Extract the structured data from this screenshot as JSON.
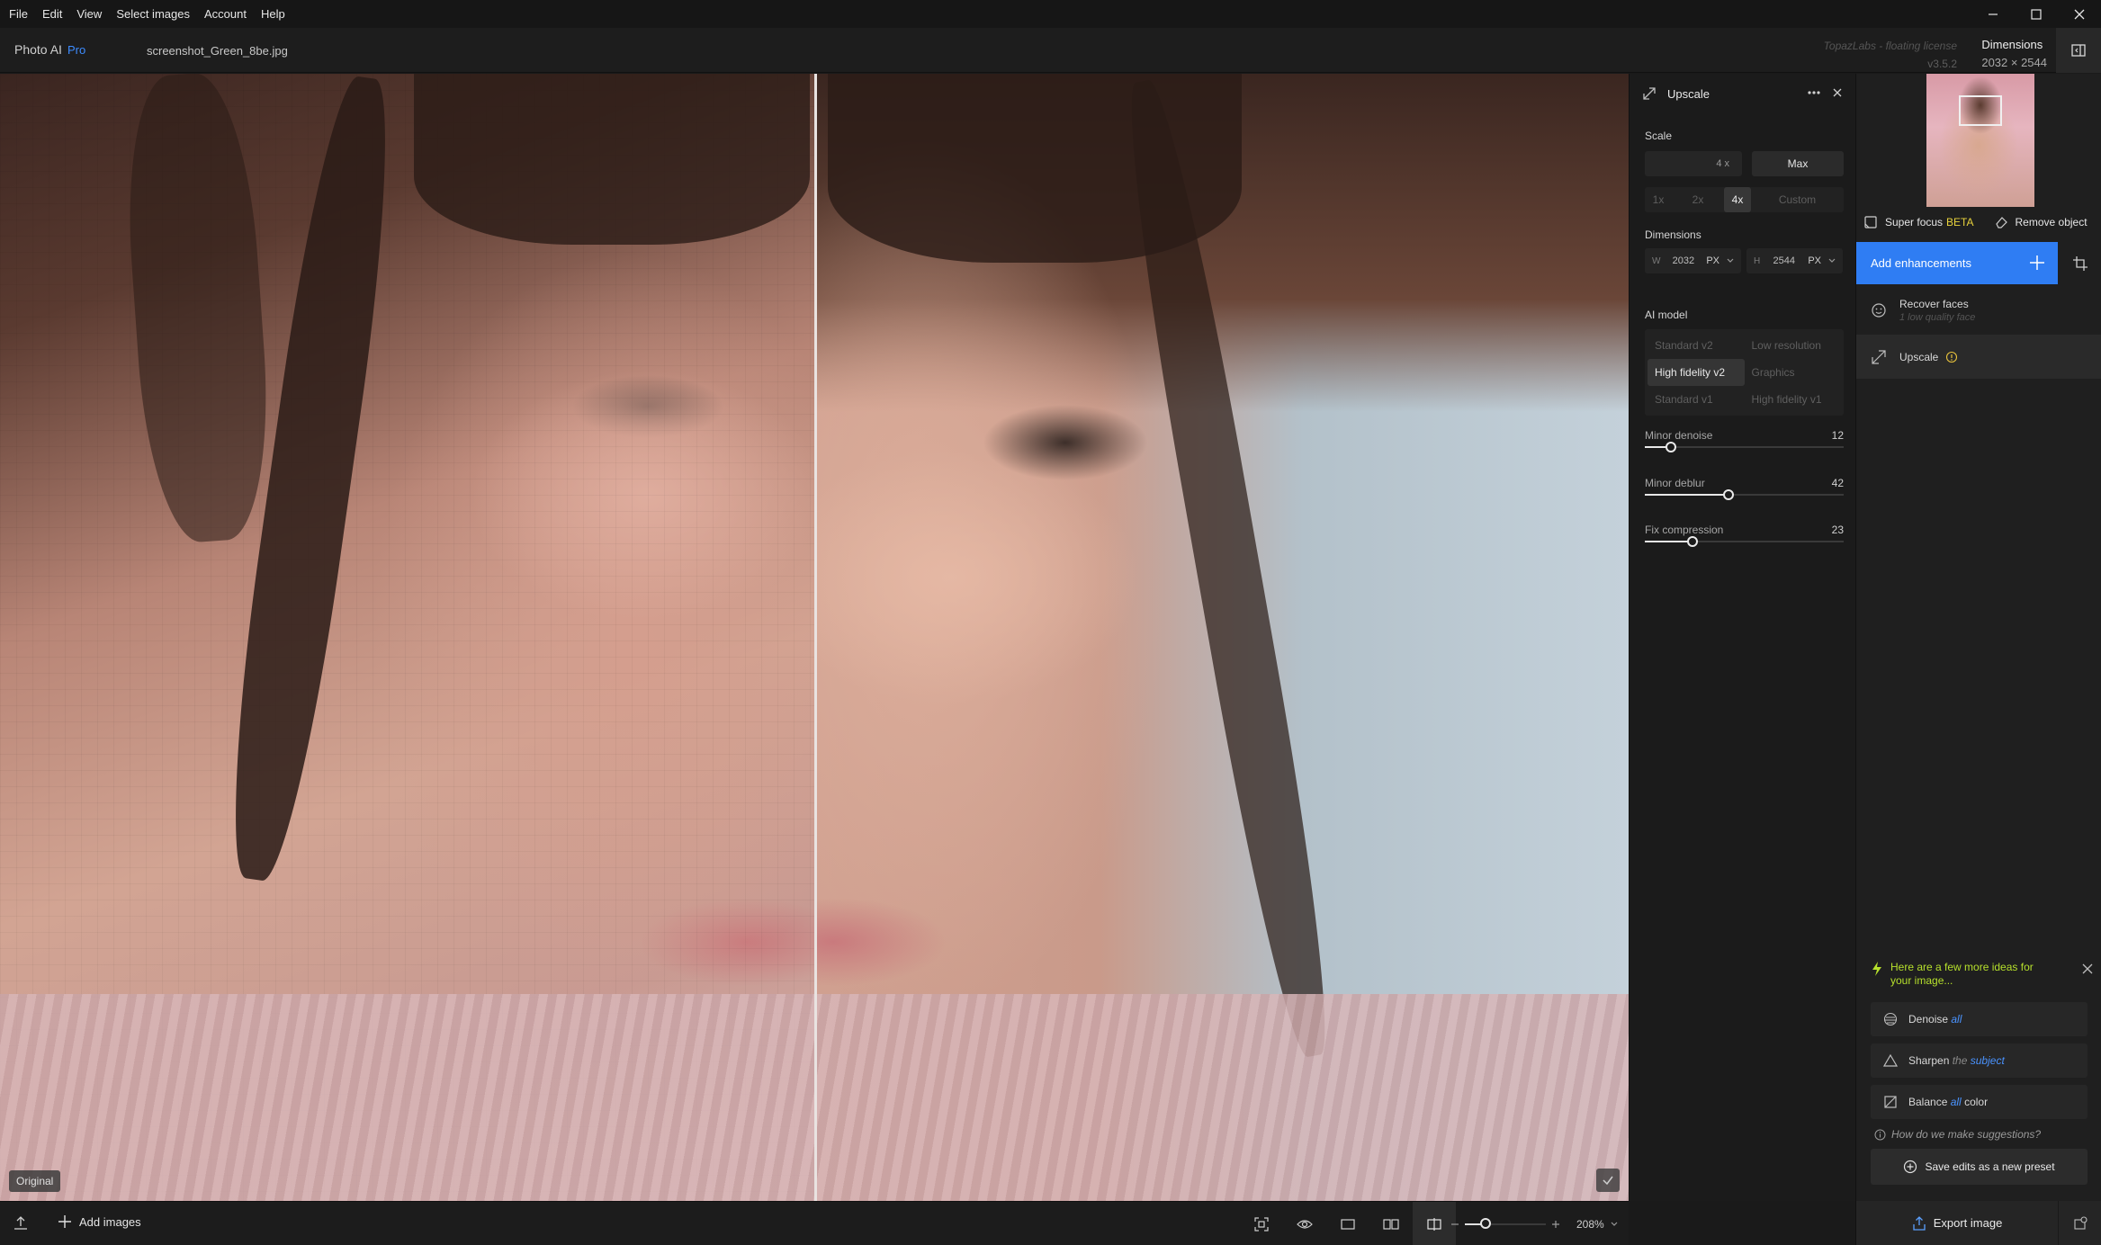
{
  "menu": [
    "File",
    "Edit",
    "View",
    "Select images",
    "Account",
    "Help"
  ],
  "app": {
    "name": "Photo AI",
    "edition": "Pro",
    "file": "screenshot_Green_8be.jpg"
  },
  "license": {
    "text": "TopazLabs - floating license",
    "version": "v3.5.2"
  },
  "dimensions_header": {
    "label": "Dimensions",
    "value": "2032 × 2544"
  },
  "viewport": {
    "badge": "Original",
    "split_fraction": 0.5
  },
  "upscale": {
    "title": "Upscale",
    "scale_label": "Scale",
    "scale_value": "4",
    "scale_unit": "x",
    "max_label": "Max",
    "scale_options": [
      {
        "label": "1x",
        "active": false
      },
      {
        "label": "2x",
        "active": false
      },
      {
        "label": "4x",
        "active": true
      },
      {
        "label": "Custom",
        "active": false
      }
    ],
    "dimensions_label": "Dimensions",
    "width": {
      "prefix": "W",
      "value": "2032",
      "unit": "PX"
    },
    "height": {
      "prefix": "H",
      "value": "2544",
      "unit": "PX"
    },
    "model_label": "AI model",
    "models": [
      {
        "label": "Standard v2",
        "active": false
      },
      {
        "label": "Low resolution",
        "active": false
      },
      {
        "label": "High fidelity v2",
        "active": true
      },
      {
        "label": "Graphics",
        "active": false
      },
      {
        "label": "Standard v1",
        "active": false
      },
      {
        "label": "High fidelity v1",
        "active": false
      }
    ],
    "sliders": [
      {
        "label": "Minor denoise",
        "value": 12,
        "level": 0.13
      },
      {
        "label": "Minor deblur",
        "value": 42,
        "level": 0.42
      },
      {
        "label": "Fix compression",
        "value": 23,
        "level": 0.24
      }
    ]
  },
  "sidebar": {
    "super_focus": "Super focus",
    "beta": "BETA",
    "remove_object": "Remove object",
    "add_enhancements": "Add enhancements",
    "enhancements": [
      {
        "name": "Recover faces",
        "sub": "1 low quality face"
      },
      {
        "name": "Upscale",
        "sub": ""
      }
    ],
    "ideas_title": "Here are a few more ideas for your image...",
    "ideas": [
      {
        "icon": "denoise-icon",
        "parts": [
          "Denoise",
          "all",
          ""
        ]
      },
      {
        "icon": "sharpen-icon",
        "parts": [
          "Sharpen",
          "the",
          "subject"
        ]
      },
      {
        "icon": "balance-icon",
        "parts": [
          "Balance",
          "all",
          "color"
        ]
      }
    ],
    "how_text": "How do we make suggestions?",
    "save_preset": "Save edits as a new preset",
    "export": "Export image"
  },
  "bottom": {
    "add_images": "Add images",
    "zoom": "208%",
    "zoom_level": 0.25
  },
  "colors": {
    "accent": "#2f7df3",
    "pro": "#3d8cff",
    "beta": "#e8d23c",
    "ideas": "#b6e02c"
  }
}
